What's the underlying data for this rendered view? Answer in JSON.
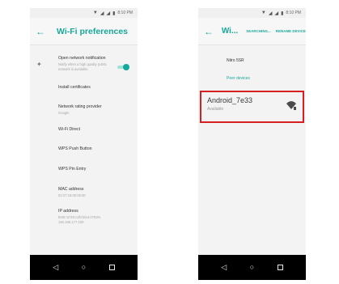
{
  "status_bar": {
    "time": "8:10 PM"
  },
  "left_screen": {
    "title": "Wi-Fi preferences",
    "preferences": [
      {
        "title": "Open network notification",
        "subtitle": "Notify when a high quality public network is available",
        "toggle_on": true
      },
      {
        "title": "Install certificates",
        "subtitle": ""
      },
      {
        "title": "Network rating provider",
        "subtitle": "Google"
      },
      {
        "title": "Wi-Fi Direct",
        "subtitle": ""
      },
      {
        "title": "WPS Push Button",
        "subtitle": ""
      },
      {
        "title": "WPS Pin Entry",
        "subtitle": ""
      },
      {
        "title": "MAC address",
        "subtitle": "02:27:15:00:00:00"
      },
      {
        "title": "IP address",
        "subtitle": "fe80::5729:c1f0:bfe4:0793%\n192.168.177.100"
      }
    ]
  },
  "right_screen": {
    "title": "Wi...",
    "actions": {
      "searching": "SEARCHING...",
      "rename": "RENAME DEVICE"
    },
    "device_name": "Nitro 5SR",
    "section_label": "Peer devices",
    "peer": {
      "name": "Android_7e33",
      "status": "Available"
    }
  },
  "colors": {
    "accent": "#19a79a",
    "highlight": "#d81f1f",
    "nav_bar": "#000000"
  },
  "icons": {
    "back": "arrow-left-icon",
    "wifi": "wifi-signal-icon",
    "nav_back": "triangle-back-icon",
    "nav_home": "circle-home-icon",
    "nav_recent": "square-recent-icon"
  }
}
